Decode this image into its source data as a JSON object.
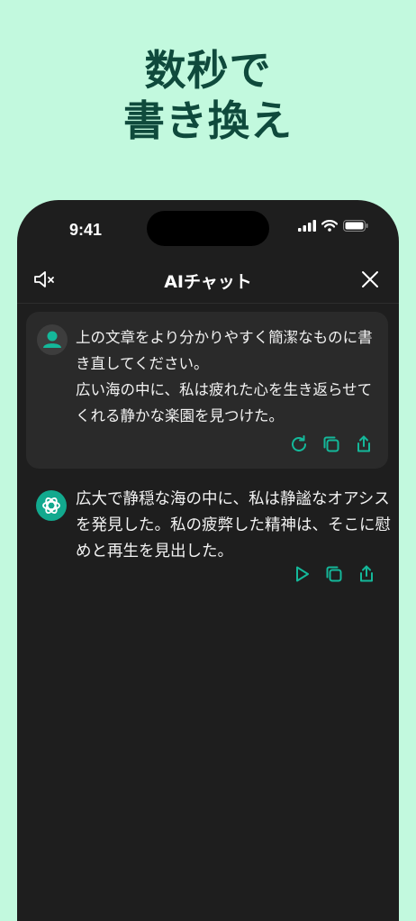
{
  "headline": {
    "line1": "数秒で",
    "line2": "書き換え"
  },
  "status_bar": {
    "time": "9:41"
  },
  "navbar": {
    "title": "AIチャット"
  },
  "user_message": {
    "lines": [
      "上の文章をより分かりやすく簡潔なものに書",
      "き直してください。",
      "広い海の中に、私は疲れた心を生き返らせて",
      "くれる静かな楽園を見つけた。"
    ]
  },
  "bot_message": {
    "lines": [
      "広大で静穏な海の中に、私は静謐なオアシス",
      "を発見した。私の疲弊した精神は、そこに慰",
      "めと再生を見出した。"
    ]
  },
  "colors": {
    "background": "#c2f9de",
    "headline": "#0f4a3c",
    "accent": "#14b89a",
    "panel": "#1e1e1e"
  },
  "icons": {
    "mute": "speaker-muted-icon",
    "close": "close-icon",
    "regenerate": "refresh-icon",
    "copy": "copy-icon",
    "share": "share-icon",
    "play": "play-icon"
  }
}
